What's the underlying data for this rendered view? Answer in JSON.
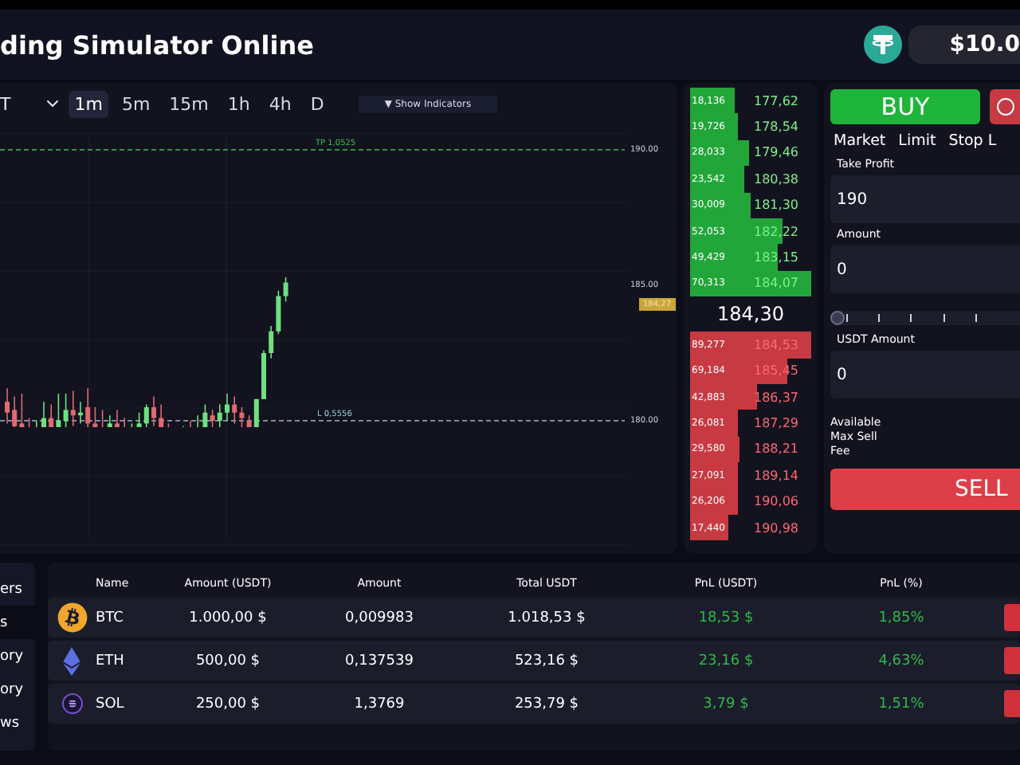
{
  "header": {
    "title": "ding Simulator Online",
    "balance": "$10.0"
  },
  "chart": {
    "pair": "T",
    "timeframes": [
      {
        "label": "1m",
        "selected": true
      },
      {
        "label": "5m",
        "selected": false
      },
      {
        "label": "15m",
        "selected": false
      },
      {
        "label": "1h",
        "selected": false
      },
      {
        "label": "4h",
        "selected": false
      },
      {
        "label": "D",
        "selected": false
      }
    ],
    "indicators_button": "▼ Show Indicators",
    "axis_labels": [
      "190.00",
      "185.00",
      "180.00"
    ],
    "take_profit_label": "TP 1,0525",
    "limit_label": "L 0,5556",
    "price_tag": "184,27"
  },
  "order_book": {
    "bids": [
      {
        "volume": "18,136",
        "price": "177,62"
      },
      {
        "volume": "19,726",
        "price": "178,54"
      },
      {
        "volume": "28,033",
        "price": "179,46"
      },
      {
        "volume": "23,542",
        "price": "180,38"
      },
      {
        "volume": "30,009",
        "price": "181,30"
      },
      {
        "volume": "52,053",
        "price": "182,22"
      },
      {
        "volume": "49,429",
        "price": "183,15"
      },
      {
        "volume": "70,313",
        "price": "184,07"
      }
    ],
    "last_price": "184,30",
    "asks": [
      {
        "volume": "89,277",
        "price": "184,53"
      },
      {
        "volume": "69,184",
        "price": "185,45"
      },
      {
        "volume": "42,883",
        "price": "186,37"
      },
      {
        "volume": "26,081",
        "price": "187,29"
      },
      {
        "volume": "29,580",
        "price": "188,21"
      },
      {
        "volume": "27,091",
        "price": "189,14"
      },
      {
        "volume": "26,206",
        "price": "190,06"
      },
      {
        "volume": "17,440",
        "price": "190,98"
      }
    ]
  },
  "trade": {
    "buy_button": "BUY",
    "order_types": [
      "Market",
      "Limit",
      "Stop L"
    ],
    "take_profit": {
      "label": "Take Profit",
      "value": "190"
    },
    "amount": {
      "label": "Amount",
      "value": "0"
    },
    "usdt_amount": {
      "label": "USDT Amount",
      "value": "0"
    },
    "slider": {
      "level": 0
    },
    "info": [
      "Available",
      "Max Sell",
      "Fee"
    ],
    "sell_button": "SELL"
  },
  "sidebar": {
    "items": [
      {
        "label": "ers",
        "selected": false
      },
      {
        "label": "s",
        "selected": true
      },
      {
        "label": "ory",
        "selected": false
      },
      {
        "label": "ory",
        "selected": false
      },
      {
        "label": "ws",
        "selected": false
      }
    ]
  },
  "table": {
    "columns": [
      "Name",
      "Amount (USDT)",
      "Amount",
      "Total USDT",
      "PnL (USDT)",
      "PnL (%)"
    ],
    "rows": [
      {
        "kind": "bitcoin",
        "name": "BTC",
        "amount_usdt": "1.000,00 $",
        "amount": "0,009983",
        "total": "1.018,53 $",
        "pnl": "18,53 $",
        "pnl_pct": "1,85%"
      },
      {
        "kind": "ethereum",
        "name": "ETH",
        "amount_usdt": "500,00 $",
        "amount": "0,137539",
        "total": "523,16 $",
        "pnl": "23,16 $",
        "pnl_pct": "4,63%"
      },
      {
        "kind": "solana",
        "name": "SOL",
        "amount_usdt": "250,00 $",
        "amount": "1,3769",
        "total": "253,79 $",
        "pnl": "3,79 $",
        "pnl_pct": "1,51%"
      }
    ]
  }
}
